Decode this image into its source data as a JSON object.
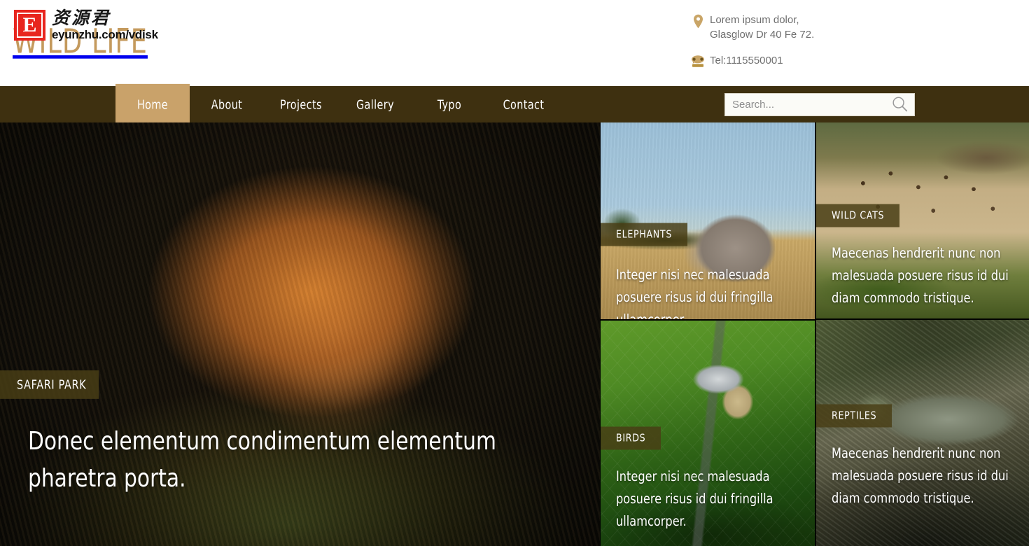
{
  "site": {
    "title": "WILD LIFE",
    "accent_tan": "#c9a26a",
    "nav_bar_color": "#3e3010",
    "tag_color": "#493e16"
  },
  "watermark": {
    "badge_letter": "E",
    "chinese": "资源君",
    "url": "eyunzhu.com/vdisk",
    "badge_color": "#e8251e"
  },
  "header": {
    "address_icon": "map-pin-icon",
    "address_line1": "Lorem ipsum dolor,",
    "address_line2": "Glasglow Dr 40 Fe 72.",
    "phone_icon": "telephone-icon",
    "phone": "Tel:1115550001"
  },
  "nav": {
    "items": [
      {
        "label": "Home",
        "active": true
      },
      {
        "label": "About",
        "active": false
      },
      {
        "label": "Projects",
        "active": false
      },
      {
        "label": "Gallery",
        "active": false
      },
      {
        "label": "Typo",
        "active": false
      },
      {
        "label": "Contact",
        "active": false
      }
    ]
  },
  "search": {
    "value": "",
    "placeholder": "Search...",
    "icon": "magnifier-icon"
  },
  "hero": {
    "tag": "SAFARI PARK",
    "title": "Donec elementum condimentum elementum pharetra porta.",
    "image": "lion-photo"
  },
  "cards": [
    {
      "tag": "ELEPHANTS",
      "desc": "Integer nisi nec malesuada posuere risus id dui fringilla ullamcorper.",
      "image": "elephant-photo"
    },
    {
      "tag": "WILD CATS",
      "desc": "Maecenas hendrerit nunc non malesuada posuere risus id dui diam commodo tristique.",
      "image": "cheetah-photo"
    },
    {
      "tag": "BIRDS",
      "desc": "Integer nisi nec malesuada posuere risus id dui fringilla ullamcorper.",
      "image": "bird-photo"
    },
    {
      "tag": "REPTILES",
      "desc": "Maecenas hendrerit nunc non malesuada posuere risus id dui diam commodo tristique.",
      "image": "iguana-photo"
    }
  ]
}
